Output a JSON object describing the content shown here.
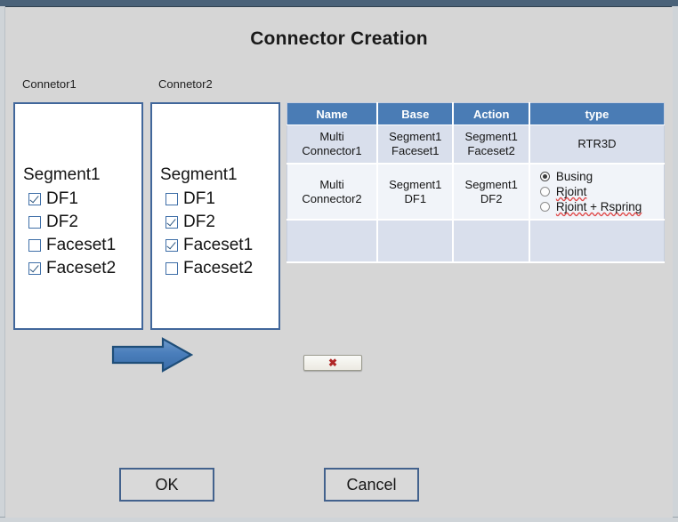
{
  "dialog": {
    "title": "Connector Creation"
  },
  "connector_panels": [
    {
      "caption": "Connetor1",
      "root": "Segment1",
      "nodes": [
        {
          "label": "DF1",
          "checked": true
        },
        {
          "label": "DF2",
          "checked": false
        },
        {
          "label": "Faceset1",
          "checked": false
        },
        {
          "label": "Faceset2",
          "checked": true
        }
      ]
    },
    {
      "caption": "Connetor2",
      "root": "Segment1",
      "nodes": [
        {
          "label": "DF1",
          "checked": false
        },
        {
          "label": "DF2",
          "checked": true
        },
        {
          "label": "Faceset1",
          "checked": true
        },
        {
          "label": "Faceset2",
          "checked": false
        }
      ]
    }
  ],
  "transfer": {
    "arrow_direction": "right",
    "delete_button_glyph": "✖"
  },
  "table": {
    "headers": [
      "Name",
      "Base",
      "Action",
      "type"
    ],
    "rows": [
      {
        "name_line1": "Multi",
        "name_line2": "Connector1",
        "base_line1": "Segment1",
        "base_line2": "Faceset1",
        "action_line1": "Segment1",
        "action_line2": "Faceset2",
        "type_text": "RTR3D"
      },
      {
        "name_line1": "Multi",
        "name_line2": "Connector2",
        "base_line1": "Segment1",
        "base_line2": "DF1",
        "action_line1": "Segment1",
        "action_line2": "DF2",
        "type_options": [
          {
            "label": "Busing",
            "selected": true,
            "misspelled": false
          },
          {
            "label": "Rjoint",
            "selected": false,
            "misspelled": true
          },
          {
            "label": "Rjoint + Rspring",
            "selected": false,
            "misspelled": true
          }
        ]
      }
    ]
  },
  "footer": {
    "ok_label": "OK",
    "cancel_label": "Cancel"
  },
  "colors": {
    "background": "#d6d6d6",
    "header_blue": "#4a7cb5",
    "panel_border": "#41679b",
    "row_alt": "#d9dfec",
    "row_main": "#f1f4f9",
    "arrow_fill": "#4a7ebb",
    "arrow_stroke": "#1f4e79",
    "delete_glyph": "#b02626",
    "button_border": "#43628d"
  }
}
